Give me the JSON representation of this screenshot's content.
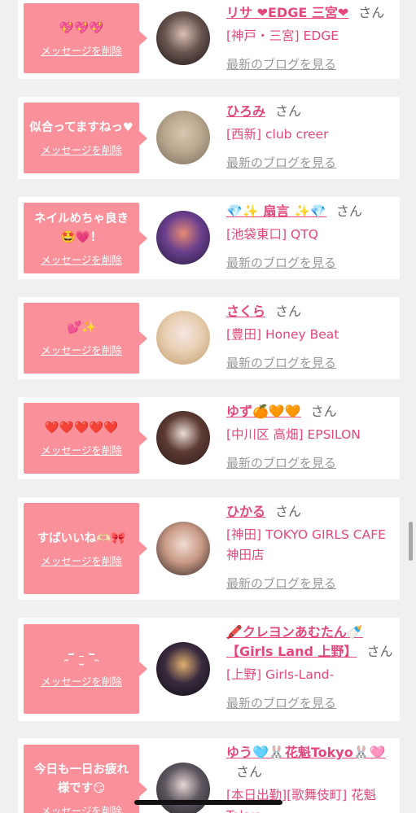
{
  "cards": [
    {
      "message": "💖💖💖",
      "delete_label": "メッセージを削除",
      "name": "リサ ❤EDGE 三宮❤",
      "honorific": "さん",
      "shop": "[神戸・三宮] EDGE",
      "blog_label": "最新のブログを見る",
      "avatar_colors": [
        "#1a1414",
        "#6a5550",
        "#d9c0b6"
      ]
    },
    {
      "message": "似合ってますねっ♥",
      "delete_label": "メッセージを削除",
      "name": "ひろみ",
      "honorific": "さん",
      "shop": "[西新] club creer",
      "blog_label": "最新のブログを見る",
      "avatar_colors": [
        "#7a6a58",
        "#b9a88f",
        "#d8c6b0"
      ]
    },
    {
      "message": "ネイルめちゃ良き🤩💗！",
      "delete_label": "メッセージを削除",
      "name": "💎✨ 扇言 ✨💎",
      "honorific": "さん",
      "shop": "[池袋東口] QTQ",
      "blog_label": "最新のブログを見る",
      "avatar_colors": [
        "#241a3a",
        "#6a3f8e",
        "#e78a74"
      ]
    },
    {
      "message": "💕✨",
      "delete_label": "メッセージを削除",
      "name": "さくら",
      "honorific": "さん",
      "shop": "[豊田] Honey Beat",
      "blog_label": "最新のブログを見る",
      "avatar_colors": [
        "#c49a6c",
        "#e7cfb1",
        "#f7e6e3"
      ]
    },
    {
      "message": "❤️❤️❤️❤️❤️",
      "delete_label": "メッセージを削除",
      "name": "ゆず🍊🧡🧡",
      "honorific": "さん",
      "shop": "[中川区 高畑] EPSILON",
      "blog_label": "最新のブログを見る",
      "avatar_colors": [
        "#2b1a18",
        "#5d3b33",
        "#eadbd6"
      ]
    },
    {
      "message": "すばいいね🫶🏻🎀",
      "delete_label": "メッセージを削除",
      "name": "ひかる",
      "honorific": "さん",
      "shop": "[神田] TOKYO GIRLS CAFE 神田店",
      "blog_label": "最新のブログを見る",
      "avatar_colors": [
        "#2c2222",
        "#c99a86",
        "#f1ddd3"
      ]
    },
    {
      "message": "˶‾᷄ ⁻̫ ‾᷅˵",
      "delete_label": "メッセージを削除",
      "name": "🖍️クレヨンあむたん🍼【Girls Land 上野】",
      "honorific": "さん",
      "shop": "[上野] Girls-Land-",
      "blog_label": "最新のブログを見る",
      "avatar_colors": [
        "#0d0d14",
        "#3a2b3e",
        "#e0b070"
      ]
    },
    {
      "message": "今日も一日お疲れ様です😏",
      "delete_label": "メッセージを削除",
      "name": "ゆう🩵🐰花魁Tokyo🐰🩷",
      "honorific": "さん",
      "shop": "[本日出勤][歌舞伎町] 花魁Tokyo",
      "blog_label": "最新のブログを見る",
      "avatar_colors": [
        "#1f1f23",
        "#5e5660",
        "#e6d6d4"
      ]
    }
  ]
}
